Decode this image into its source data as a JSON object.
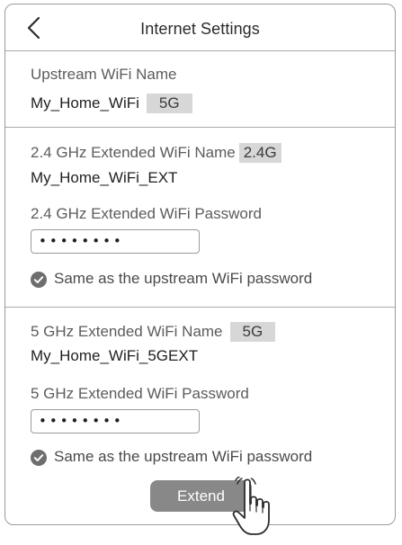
{
  "header": {
    "title": "Internet Settings",
    "back_icon": "chevron-left-icon"
  },
  "upstream": {
    "label": "Upstream WiFi Name",
    "ssid": "My_Home_WiFi",
    "band": "5G"
  },
  "band_24": {
    "name_label": "2.4 GHz Extended WiFi Name",
    "band": "2.4G",
    "ssid": "My_Home_WiFi_EXT",
    "password_label": "2.4 GHz Extended WiFi Password",
    "password_value": "••••••••",
    "same_password_label": "Same as the upstream WiFi password",
    "same_password_checked": true
  },
  "band_5": {
    "name_label": "5 GHz Extended WiFi Name",
    "band": "5G",
    "ssid": "My_Home_WiFi_5GEXT",
    "password_label": "5 GHz Extended WiFi Password",
    "password_value": "••••••••",
    "same_password_label": "Same as the upstream WiFi password",
    "same_password_checked": true
  },
  "actions": {
    "extend_label": "Extend"
  },
  "colors": {
    "tag_background": "#d7d7d7",
    "button_background": "#888888",
    "check_icon": "#6e6e6e",
    "border": "#9a9a9a"
  },
  "icons": {
    "check": "check-circle-icon",
    "pointer": "hand-pointer-icon"
  }
}
